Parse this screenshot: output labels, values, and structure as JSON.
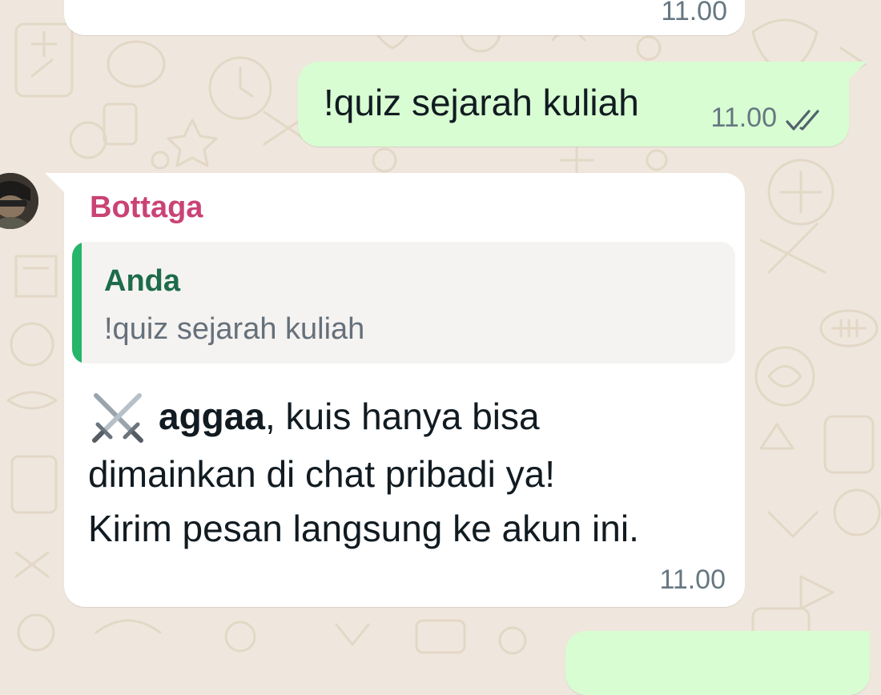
{
  "colors": {
    "chat_background": "#efe7dd",
    "incoming_bubble": "#ffffff",
    "outgoing_bubble": "#d8fdd2",
    "sender_name": "#c94375",
    "quote_bar": "#25b56b",
    "quote_author": "#1d6b4a",
    "read_ticks": "#53616b"
  },
  "messages": {
    "top": {
      "time": "11.00"
    },
    "outgoing": {
      "text": "!quiz sejarah kuliah",
      "time": "11.00",
      "status_icon": "double-check-icon"
    },
    "bot": {
      "sender": "Bottaga",
      "avatar_icon": "avatar-icon",
      "quote": {
        "author": "Anda",
        "text": "!quiz sejarah kuliah"
      },
      "emoji_icon": "crossed-swords-icon",
      "mention": "aggaa",
      "line1_rest": ", kuis hanya bisa",
      "line2": "dimainkan di chat pribadi ya!",
      "line3": "Kirim pesan langsung ke akun ini.",
      "time": "11.00"
    }
  }
}
